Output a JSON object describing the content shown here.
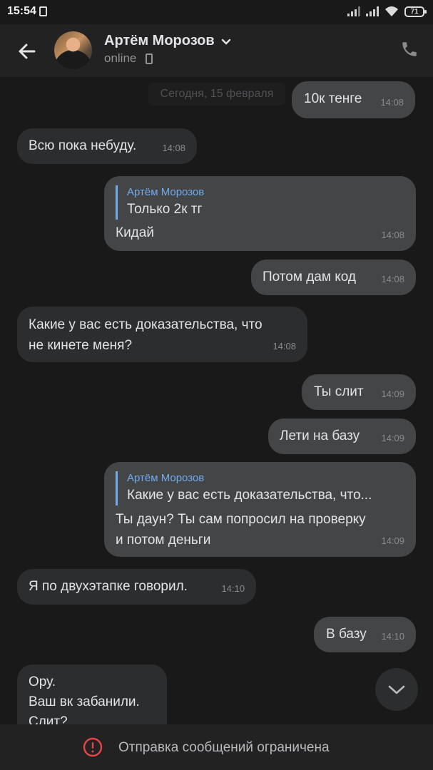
{
  "status_bar": {
    "time": "15:54",
    "battery": "71"
  },
  "header": {
    "contact_name": "Артём Морозов",
    "status": "online"
  },
  "date_separator": "Сегодня, 15 февраля",
  "messages": [
    {
      "dir": "out",
      "text": "10к тенге",
      "time": "14:08"
    },
    {
      "dir": "in",
      "text": "Всю пока небуду.",
      "time": "14:08"
    },
    {
      "dir": "out",
      "reply_name": "Артём Морозов",
      "reply_text": "Только 2к тг",
      "text": "Кидай",
      "time": "14:08"
    },
    {
      "dir": "out",
      "text": "Потом дам код",
      "time": "14:08"
    },
    {
      "dir": "in",
      "text": "Какие у вас есть доказательства, что\nне кинете меня?",
      "time": "14:08"
    },
    {
      "dir": "out",
      "text": "Ты слит",
      "time": "14:09"
    },
    {
      "dir": "out",
      "text": "Лети на базу",
      "time": "14:09"
    },
    {
      "dir": "out",
      "reply_name": "Артём Морозов",
      "reply_text": "Какие у вас есть доказательства, что...",
      "text": "Ты даун? Ты сам попросил на проверку\nи потом деньги",
      "time": "14:09"
    },
    {
      "dir": "in",
      "text": "Я по двухэтапке говорил.",
      "time": "14:10"
    },
    {
      "dir": "out",
      "text": "В базу",
      "time": "14:10"
    },
    {
      "dir": "in",
      "text": "Ору.\nВаш вк забанили.\nСлит?",
      "time": ""
    }
  ],
  "bottom_bar": {
    "notice": "Отправка сообщений ограничена"
  },
  "colors": {
    "accent": "#71aaeb",
    "incoming": "#2c2d2e",
    "outgoing": "#444546",
    "warning": "#e64646"
  },
  "icons": {
    "back": "arrow-left-icon",
    "call": "phone-icon",
    "scroll": "chevron-down-icon",
    "warning": "exclamation-circle-icon"
  }
}
